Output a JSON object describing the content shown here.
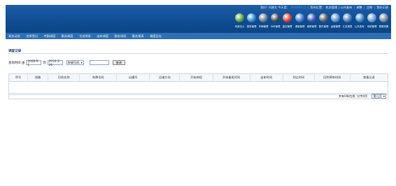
{
  "topbar": {
    "text_1": "您好! 刘源文 今天是：",
    "user": "2010年1月",
    "text_2": "您的位置：",
    "location": "机务管理 | 公共查询",
    "links": [
      "调整",
      "注销",
      "您好记录"
    ]
  },
  "modules": [
    {
      "label": "内部办公",
      "icon": "person-icon",
      "color": "#5aa23a"
    },
    {
      "label": "乘务管理",
      "icon": "monitor-icon",
      "color": "#2f8fd6"
    },
    {
      "label": "车辆管理",
      "icon": "gauge-icon",
      "color": "#6b7c8f"
    },
    {
      "label": "今年管理",
      "icon": "power-icon",
      "color": "#3f4a55"
    },
    {
      "label": "监控管理",
      "icon": "alarm-icon",
      "color": "#d8402b"
    },
    {
      "label": "调度管理",
      "icon": "bottle-icon",
      "color": "#3a7bd5"
    },
    {
      "label": "维修管理",
      "icon": "book-icon",
      "color": "#3b58b8"
    },
    {
      "label": "配件管理",
      "icon": "counter-icon",
      "color": "#58606a"
    },
    {
      "label": "运营管理",
      "icon": "chart-icon",
      "color": "#5a8fd0"
    },
    {
      "label": "汇总报表",
      "icon": "clipboard-icon",
      "color": "#4c7fbf"
    },
    {
      "label": "公共查询",
      "icon": "globe-icon",
      "color": "#3b87cf"
    },
    {
      "label": "系统管理",
      "icon": "mountain-icon",
      "color": "#6f9cd4"
    },
    {
      "label": "数据采集",
      "icon": "device-icon",
      "color": "#7a8899"
    }
  ],
  "nav": [
    "乘务动态",
    "违章登记",
    "考勤调度",
    "勤务调度",
    "生成排班",
    "出车调度",
    "勤务排班",
    "勤务报表",
    "调度日志"
  ],
  "nav_active_index": 8,
  "panel": {
    "title": "调度记录"
  },
  "filter": {
    "label_time": "查询时间 由",
    "date_from": "2008-9-1",
    "label_to": "到",
    "date_to": "2010-3-26",
    "type_select": "车辆号码",
    "keyword": "",
    "search_button": "查询"
  },
  "table": {
    "headers": [
      "序号",
      "线路",
      "司机名称",
      "车牌号码",
      "自编号",
      "运输方向",
      "开始排程",
      "开始备班时间",
      "出车时间",
      "到达时间",
      "回到停车时间",
      "查看记录"
    ]
  },
  "footer": {
    "summary": "共有0条信息, 分为0页",
    "page_select": "第几页"
  }
}
